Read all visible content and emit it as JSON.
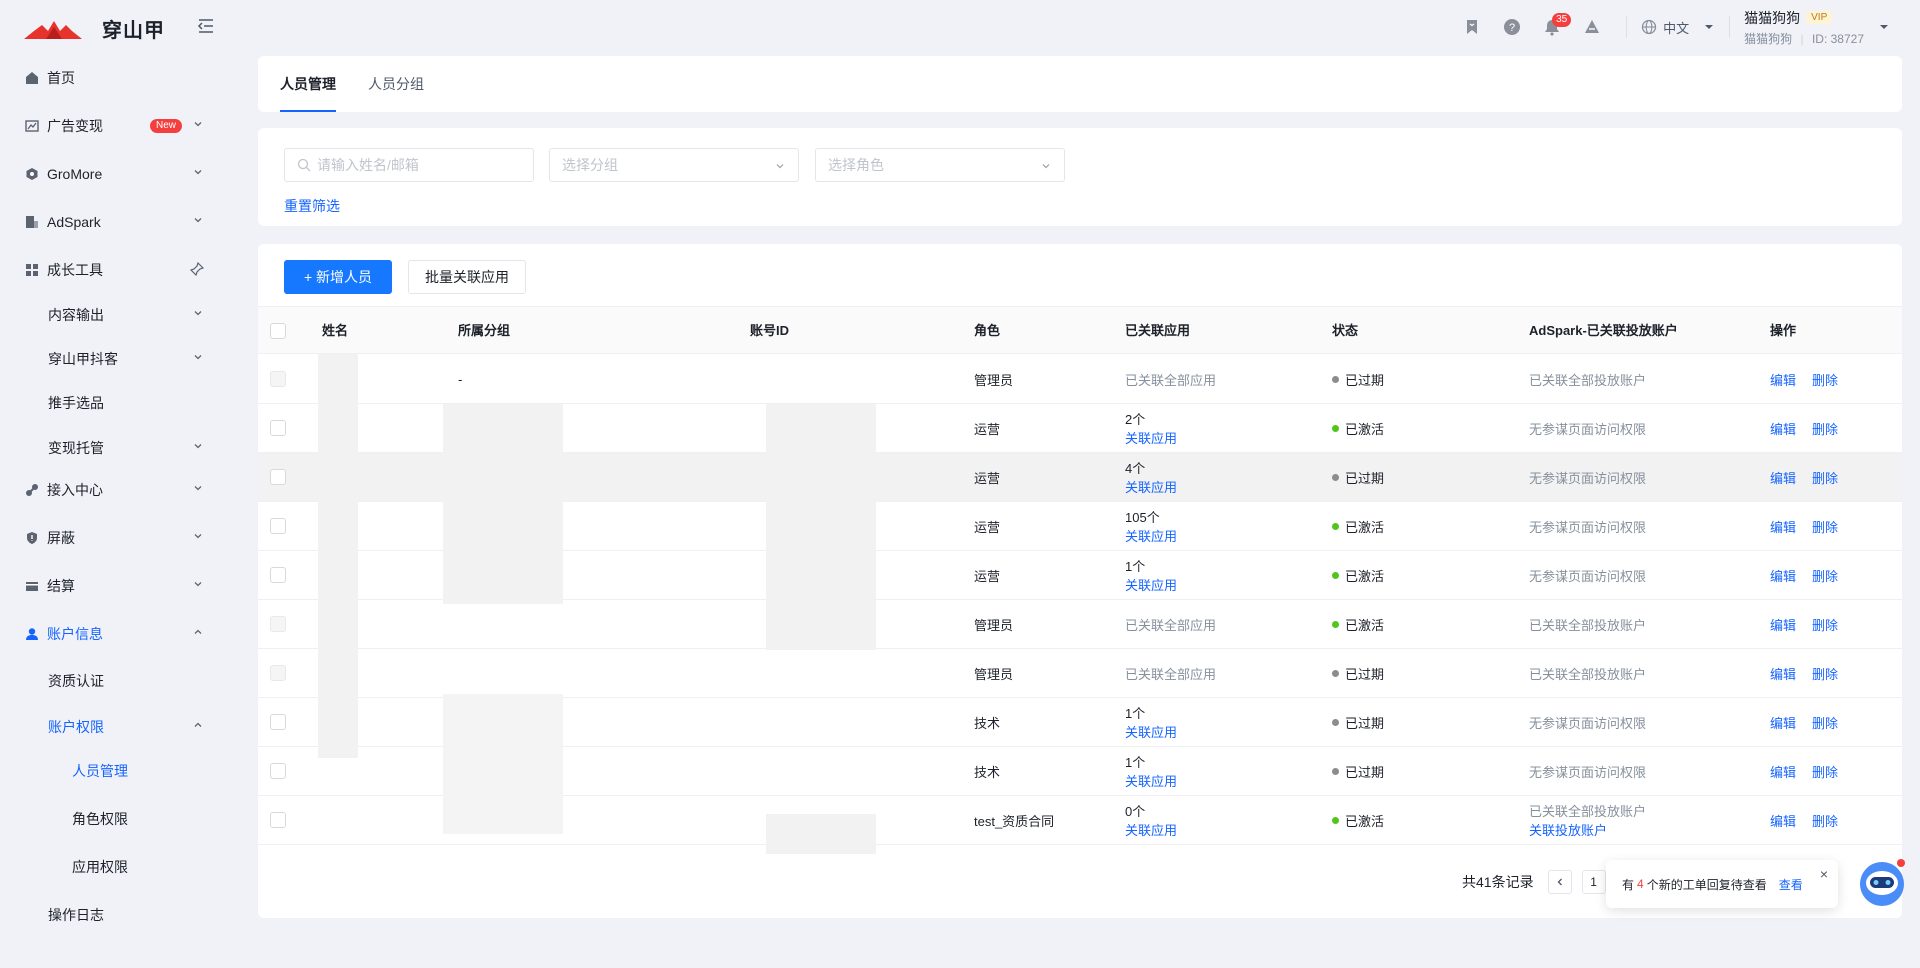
{
  "header": {
    "logo_text": "穿山甲",
    "notification_count": "35",
    "language": "中文",
    "username": "猫猫狗狗",
    "vip_label": "VIP",
    "sub_name": "猫猫狗狗",
    "account_id": "ID: 38727"
  },
  "sidebar": {
    "items": [
      {
        "label": "首页"
      },
      {
        "label": "广告变现",
        "badge": "New"
      },
      {
        "label": "GroMore"
      },
      {
        "label": "AdSpark"
      },
      {
        "label": "成长工具"
      },
      {
        "label": "内容输出"
      },
      {
        "label": "穿山甲抖客"
      },
      {
        "label": "推手选品"
      },
      {
        "label": "变现托管"
      },
      {
        "label": "接入中心"
      },
      {
        "label": "屏蔽"
      },
      {
        "label": "结算"
      },
      {
        "label": "账户信息"
      },
      {
        "label": "资质认证"
      },
      {
        "label": "账户权限"
      },
      {
        "label": "人员管理"
      },
      {
        "label": "角色权限"
      },
      {
        "label": "应用权限"
      },
      {
        "label": "操作日志"
      }
    ]
  },
  "tabs": [
    {
      "label": "人员管理"
    },
    {
      "label": "人员分组"
    }
  ],
  "filters": {
    "search_placeholder": "请输入姓名/邮箱",
    "group_placeholder": "选择分组",
    "role_placeholder": "选择角色",
    "reset_label": "重置筛选"
  },
  "toolbar": {
    "add_label": "+ 新增人员",
    "batch_label": "批量关联应用"
  },
  "table": {
    "columns": [
      "姓名",
      "所属分组",
      "账号ID",
      "角色",
      "已关联应用",
      "状态",
      "AdSpark-已关联投放账户",
      "操作"
    ],
    "edit_label": "编辑",
    "delete_label": "删除",
    "link_label": "关联应用",
    "rows": [
      {
        "group": "-",
        "role": "管理员",
        "apps": "已关联全部应用",
        "status": "已过期",
        "adspark": "已关联全部投放账户"
      },
      {
        "group": "",
        "role": "运营",
        "apps": "2个",
        "status": "已激活",
        "adspark": "无参谋页面访问权限"
      },
      {
        "group": "",
        "role": "运营",
        "apps": "4个",
        "status": "已过期",
        "adspark": "无参谋页面访问权限"
      },
      {
        "group": "",
        "role": "运营",
        "apps": "105个",
        "status": "已激活",
        "adspark": "无参谋页面访问权限"
      },
      {
        "group": "",
        "role": "运营",
        "apps": "1个",
        "status": "已激活",
        "adspark": "无参谋页面访问权限"
      },
      {
        "group": "",
        "role": "管理员",
        "apps": "已关联全部应用",
        "status": "已激活",
        "adspark": "已关联全部投放账户"
      },
      {
        "group": "",
        "role": "管理员",
        "apps": "已关联全部应用",
        "status": "已过期",
        "adspark": "已关联全部投放账户"
      },
      {
        "group": "",
        "role": "技术",
        "apps": "1个",
        "status": "已过期",
        "adspark": "无参谋页面访问权限"
      },
      {
        "group": "",
        "role": "技术",
        "apps": "1个",
        "status": "已过期",
        "adspark": "无参谋页面访问权限"
      },
      {
        "group": "",
        "role": "test_资质合同",
        "apps": "0个",
        "status": "已激活",
        "adspark": "已关联全部投放账户",
        "adspark_link": "关联投放账户"
      }
    ]
  },
  "status_colors": {
    "active": "#52c41a",
    "expired": "#8c8c8c"
  },
  "pagination": {
    "total_label": "共41条记录",
    "current_page": "1"
  },
  "notice": {
    "prefix": "有",
    "count": "4",
    "suffix": "个新的工单回复待查看",
    "action": "查看",
    "close": "×"
  },
  "colors": {
    "accent": "#1664ff",
    "danger": "#f53f3f"
  }
}
